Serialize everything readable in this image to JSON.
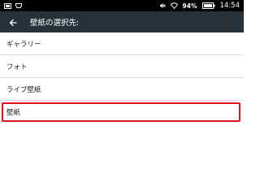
{
  "status_bar": {
    "battery_level": "94%",
    "time": "14:54",
    "icons": [
      "screenshot-icon",
      "hdmi-icon",
      "mute-icon",
      "wifi-icon",
      "battery-icon"
    ]
  },
  "app_bar": {
    "title": "壁紙の選択先:",
    "back_icon": "arrow-left-icon",
    "background": "#263238"
  },
  "list": {
    "items": [
      {
        "label": "ギャラリー"
      },
      {
        "label": "フォト"
      },
      {
        "label": "ライブ壁紙"
      },
      {
        "label": "壁紙",
        "highlighted": true,
        "highlight_color": "#e0131b"
      }
    ]
  }
}
